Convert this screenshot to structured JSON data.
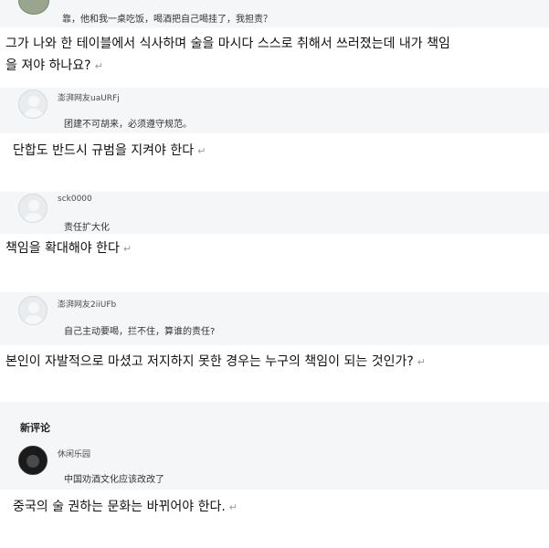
{
  "top_comment": {
    "text": "靠，他和我一桌吃饭，喝酒把自己喝挂了，我担责？"
  },
  "translation_1": {
    "line1": "그가 나와 한 테이블에서 식사하며 술을 마시다 스스로 취해서 쓰러졌는데 내가 책임",
    "line2": "을 져야 하나요?",
    "mark": "↵"
  },
  "comment_1": {
    "user": "澎湃网友uaURFj",
    "text": "团建不可胡来，必须遵守规范。"
  },
  "translation_2": {
    "text": "단합도 반드시 규범을 지켜야 한다",
    "mark": "↵"
  },
  "comment_2": {
    "user": "sck0000",
    "text": "责任扩大化"
  },
  "translation_3": {
    "text": "책임을 확대해야 한다",
    "mark": "↵"
  },
  "comment_3": {
    "user": "澎湃网友2iiUFb",
    "text": "自己主动要喝，拦不住，算谁的责任?"
  },
  "translation_4": {
    "text": "본인이 자발적으로 마셨고 저지하지 못한 경우는 누구의 책임이 되는 것인가?",
    "mark": "↵"
  },
  "new_comments": {
    "heading": "新评论"
  },
  "comment_4": {
    "user": "休闲乐园",
    "text": "中国劝酒文化应该改改了"
  },
  "translation_5": {
    "text": "중국의 술 권하는 문화는 바뀌어야 한다.",
    "mark": "↵"
  },
  "colors": {
    "comment_bg": "#f4f6f8",
    "text": "#111111",
    "return_mark": "#9a9a9a"
  },
  "icons": [
    "default-avatar-icon",
    "user-photo-avatar-icon"
  ]
}
